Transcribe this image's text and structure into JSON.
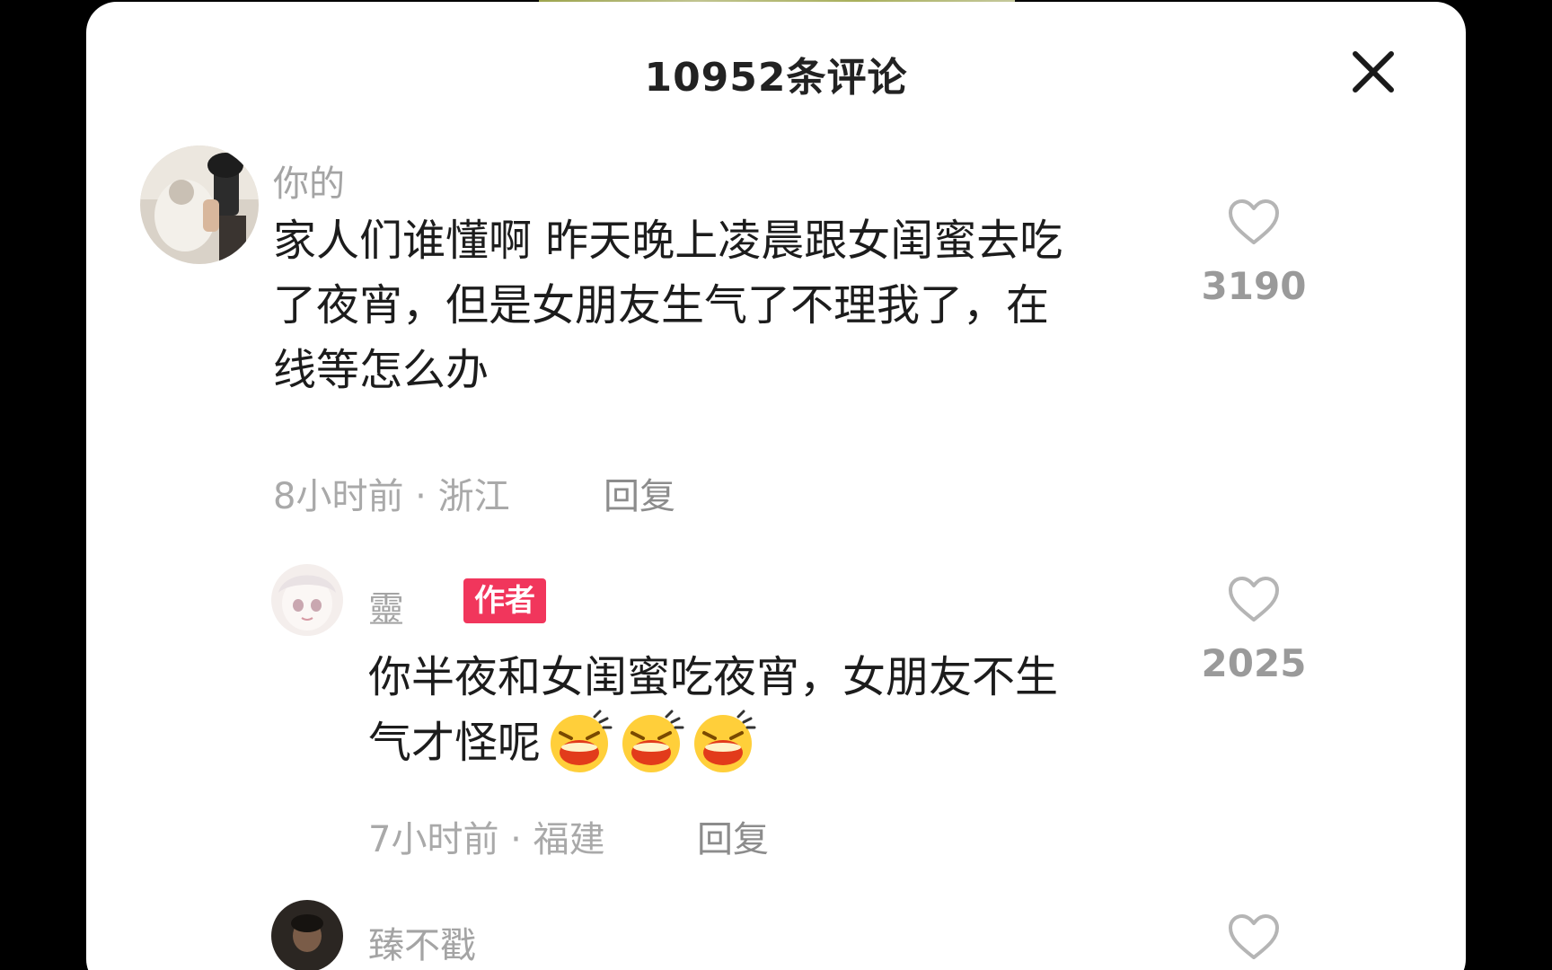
{
  "panel": {
    "title": "10952条评论"
  },
  "comments": [
    {
      "username": "你的",
      "text_lines": [
        "家人们谁懂啊 昨天晚上凌晨跟女闺蜜去吃",
        "了夜宵，但是女朋友生气了不理我了，在",
        "线等怎么办"
      ],
      "time_location": "8小时前 · 浙江",
      "reply_label": "回复",
      "likes": "3190"
    },
    {
      "username": "靈",
      "badge": "作者",
      "text_lines": [
        "你半夜和女闺蜜吃夜宵，女朋友不生",
        "气才怪呢"
      ],
      "time_location": "7小时前 · 福建",
      "reply_label": "回复",
      "likes": "2025",
      "emoji": "laughing-crying-emoji"
    },
    {
      "username": "臻不戳"
    }
  ],
  "icons": {
    "close": "close-icon",
    "like": "heart-outline-icon"
  },
  "colors": {
    "badge": "#f1365c",
    "text": "#1c1c1c",
    "muted": "#a4a4a4"
  }
}
